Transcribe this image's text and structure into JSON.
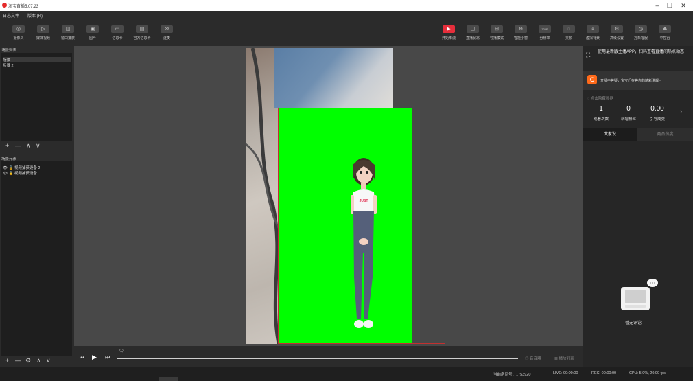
{
  "app": {
    "title": "淘宝直播5.07.23"
  },
  "window_controls": {
    "minimize": "–",
    "maximize": "❐",
    "close": "✕"
  },
  "menu": [
    "日志文件",
    "版本 (H)"
  ],
  "toolbar_left": [
    {
      "label": "摄像头",
      "icon": "camera-icon",
      "glyph": "◎"
    },
    {
      "label": "媒体视频",
      "icon": "play-icon",
      "glyph": "▷"
    },
    {
      "label": "窗口捕获",
      "icon": "window-icon",
      "glyph": "◫"
    },
    {
      "label": "图片",
      "icon": "image-icon",
      "glyph": "▣"
    },
    {
      "label": "信息卡",
      "icon": "card-icon",
      "glyph": "▭"
    },
    {
      "label": "官方信息卡",
      "icon": "official-card-icon",
      "glyph": "▤"
    },
    {
      "label": "连麦",
      "icon": "link-mic-icon",
      "glyph": "⚯"
    }
  ],
  "toolbar_right": [
    {
      "label": "开始推流",
      "icon": "start-stream-icon",
      "glyph": "▶",
      "accent": true
    },
    {
      "label": "直播状态",
      "icon": "live-status-icon",
      "glyph": "▢"
    },
    {
      "label": "导播模式",
      "icon": "director-icon",
      "glyph": "⊟"
    },
    {
      "label": "智能小窗",
      "icon": "smart-window-icon",
      "glyph": "⊖"
    },
    {
      "label": "分辨率",
      "icon": "resolution-icon",
      "glyph": "720P"
    },
    {
      "label": "美颜",
      "icon": "beauty-icon",
      "glyph": "◌"
    },
    {
      "label": "虚拟背景",
      "icon": "virtual-bg-icon",
      "glyph": "⌕"
    },
    {
      "label": "高级设置",
      "icon": "advanced-settings-icon",
      "glyph": "⚙"
    },
    {
      "label": "万象客服",
      "icon": "customer-service-icon",
      "glyph": "◷"
    },
    {
      "label": "中控台",
      "icon": "console-icon",
      "glyph": "⏏"
    }
  ],
  "scenes": {
    "header": "场景列表",
    "items": [
      "场景",
      "场景 2"
    ]
  },
  "sources": {
    "header": "场景元素",
    "items": [
      "视频捕获设备 2",
      "视频捕获设备"
    ]
  },
  "scene_controls": [
    "+",
    "—",
    "∧",
    "∨"
  ],
  "source_controls": [
    "+",
    "—",
    "⚙",
    "∧",
    "∨"
  ],
  "player": {
    "audio": "音音器",
    "playlist": "播放列表"
  },
  "promo": {
    "text": "使用最新版主播APP，扫码查看直播间热点动态"
  },
  "notice": {
    "text": "开播中答疑，宝宝们在等你的精彩讲解~"
  },
  "stats": {
    "header": "点击隐藏数据",
    "items": [
      {
        "value": "1",
        "label": "观看次数"
      },
      {
        "value": "0",
        "label": "新增粉丝"
      },
      {
        "value": "0.00",
        "label": "引导成交"
      }
    ]
  },
  "comments_tabs": [
    "大家说",
    "商品热度"
  ],
  "empty_comments": "暂无评论",
  "status": {
    "room": "当前房间号：1753920",
    "live": "LIVE: 00:00:00",
    "rec": "REC: 00:00:00",
    "cpu": "CPU: 5.0%, 20.00 fps"
  },
  "colors": {
    "accent": "#e62e3b",
    "greenscreen": "#00ff00",
    "selection": "#c23030"
  }
}
